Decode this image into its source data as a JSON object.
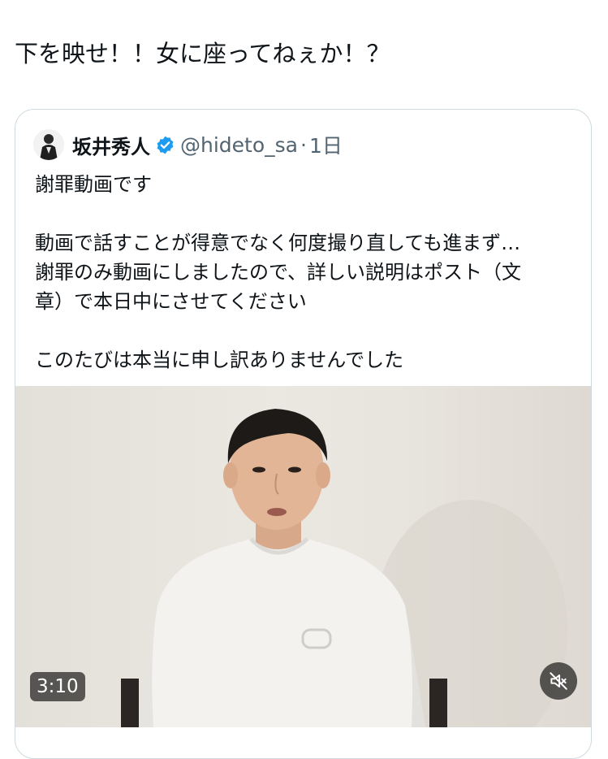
{
  "post": {
    "text": "下を映せ！！女に座ってねぇか！？"
  },
  "quote": {
    "author_name": "坂井秀人",
    "handle": "@hideto_sa",
    "separator": "·",
    "time": "1日",
    "verified_icon": "verified-badge-icon",
    "lines": {
      "l1": "謝罪動画です",
      "l2": "動画で話すことが得意でなく何度撮り直しても進まず…",
      "l3": "謝罪のみ動画にしましたので、詳しい説明はポスト（文",
      "l4": "章）で本日中にさせてください",
      "l5": "このたびは本当に申し訳ありませんでした"
    }
  },
  "video": {
    "duration": "3:10",
    "mute_icon": "speaker-muted-icon"
  },
  "colors": {
    "text": "#0f1419",
    "secondary_text": "#536471",
    "border": "#cfd9de",
    "verified": "#1d9bf0"
  }
}
